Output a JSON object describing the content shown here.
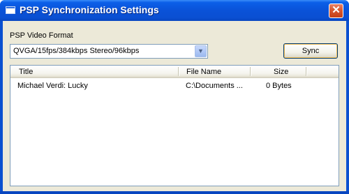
{
  "window": {
    "title": "PSP Synchronization Settings",
    "close_glyph": "✕"
  },
  "format": {
    "label": "PSP Video Format",
    "selected": "QVGA/15fps/384kbps Stereo/96kbps",
    "dropdown_glyph": "▼"
  },
  "sync_button": {
    "label": "Sync"
  },
  "list": {
    "columns": [
      "Title",
      "File Name",
      "Size"
    ],
    "rows": [
      {
        "title": "Michael Verdi: Lucky",
        "file_name": "C:\\Documents ...",
        "size": "0 Bytes"
      }
    ]
  },
  "icons": {
    "window_icon": "window-icon",
    "close": "close-icon",
    "dropdown": "chevron-down-icon"
  },
  "colors": {
    "titlebar": "#0a52d8",
    "client_bg": "#ece9d8",
    "close_button": "#d9582f",
    "field_border": "#7f9db9"
  }
}
